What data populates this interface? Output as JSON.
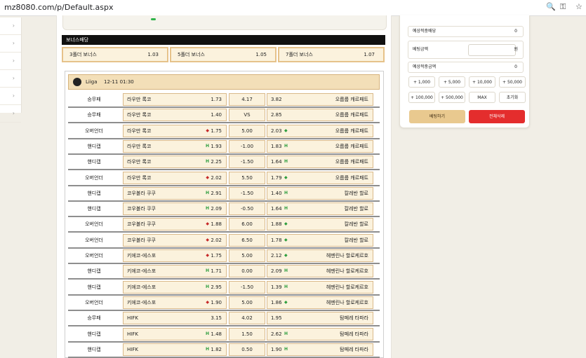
{
  "browser": {
    "url": "mz8080.com/p/Default.aspx",
    "zoom_icon": "magnifier-icon",
    "key_icon": "key-icon",
    "star_icon": "star-icon"
  },
  "sidebar": {
    "items": [
      "›",
      "›",
      "›",
      "›",
      "›",
      "›"
    ]
  },
  "bonus": {
    "header": "보너스배당",
    "items": [
      {
        "label": "3폴더 보너스",
        "value": "1.03"
      },
      {
        "label": "5폴더 보너스",
        "value": "1.05"
      },
      {
        "label": "7폴더 보너스",
        "value": "1.07"
      }
    ]
  },
  "league": {
    "name": "Liiga",
    "time": "12-11 01:30"
  },
  "rows": [
    {
      "type": "승무패",
      "home": "라우만 록코",
      "home_odd": "1.73",
      "mid": "4.17",
      "away_odd": "3.82",
      "away": "오룹룹 캐르패트",
      "hm": "",
      "am": ""
    },
    {
      "type": "승무패",
      "home": "라우만 록코",
      "home_odd": "1.40",
      "mid": "VS",
      "away_odd": "2.85",
      "away": "오룹룹 캐르패트",
      "hm": "",
      "am": ""
    },
    {
      "type": "오버언더",
      "home": "라우만 록코",
      "home_odd": "1.75",
      "mid": "5.00",
      "away_odd": "2.03",
      "away": "오룹룹 캐르패트",
      "hm": "◆",
      "am": "◆"
    },
    {
      "type": "핸디캡",
      "home": "라우만 록코",
      "home_odd": "1.93",
      "mid": "-1.00",
      "away_odd": "1.83",
      "away": "오룹룹 캐르패트",
      "hm": "H",
      "am": "H"
    },
    {
      "type": "핸디캡",
      "home": "라우만 록코",
      "home_odd": "2.25",
      "mid": "-1.50",
      "away_odd": "1.64",
      "away": "오룹룹 캐르패트",
      "hm": "H",
      "am": "H"
    },
    {
      "type": "오버언더",
      "home": "라우만 록코",
      "home_odd": "2.02",
      "mid": "5.50",
      "away_odd": "1.79",
      "away": "오룹룹 캐르패트",
      "hm": "◆",
      "am": "◆"
    },
    {
      "type": "핸디캡",
      "home": "코우볼라 쿠쿠",
      "home_odd": "2.91",
      "mid": "-1.50",
      "away_odd": "1.40",
      "away": "칼레반 할로",
      "hm": "H",
      "am": "H"
    },
    {
      "type": "핸디캡",
      "home": "코우볼라 쿠쿠",
      "home_odd": "2.09",
      "mid": "-0.50",
      "away_odd": "1.64",
      "away": "칼레반 할로",
      "hm": "H",
      "am": "H"
    },
    {
      "type": "오버언더",
      "home": "코우볼라 쿠쿠",
      "home_odd": "1.88",
      "mid": "6.00",
      "away_odd": "1.88",
      "away": "칼레반 할로",
      "hm": "◆",
      "am": "◆"
    },
    {
      "type": "오버언더",
      "home": "코우볼라 쿠쿠",
      "home_odd": "2.02",
      "mid": "6.50",
      "away_odd": "1.78",
      "away": "칼레반 할로",
      "hm": "◆",
      "am": "◆"
    },
    {
      "type": "오버언더",
      "home": "키에코-에스포",
      "home_odd": "1.75",
      "mid": "5.00",
      "away_odd": "2.12",
      "away": "헤멘린나 할로케르호",
      "hm": "◆",
      "am": "◆"
    },
    {
      "type": "핸디캡",
      "home": "키에코-에스포",
      "home_odd": "1.71",
      "mid": "0.00",
      "away_odd": "2.09",
      "away": "헤멘린나 할로케르호",
      "hm": "H",
      "am": "H"
    },
    {
      "type": "핸디캡",
      "home": "키에코-에스포",
      "home_odd": "2.95",
      "mid": "-1.50",
      "away_odd": "1.39",
      "away": "헤멘린나 할로케르호",
      "hm": "H",
      "am": "H"
    },
    {
      "type": "오버언더",
      "home": "키에코-에스포",
      "home_odd": "1.90",
      "mid": "5.00",
      "away_odd": "1.86",
      "away": "헤멘린나 할로케르호",
      "hm": "◆",
      "am": "◆"
    },
    {
      "type": "승무패",
      "home": "HIFK",
      "home_odd": "3.15",
      "mid": "4.02",
      "away_odd": "1.95",
      "away": "탐페레 타파라",
      "hm": "",
      "am": ""
    },
    {
      "type": "핸디캡",
      "home": "HIFK",
      "home_odd": "1.48",
      "mid": "1.50",
      "away_odd": "2.62",
      "away": "탐페레 타파라",
      "hm": "H",
      "am": "H"
    },
    {
      "type": "핸디캡",
      "home": "HIFK",
      "home_odd": "1.82",
      "mid": "0.50",
      "away_odd": "1.90",
      "away": "탐페레 타파라",
      "hm": "H",
      "am": "H"
    }
  ],
  "slip": {
    "expected_odds_label": "예상적중배당",
    "expected_odds_value": "0",
    "bet_amount_label": "베팅금액",
    "bet_amount_value": "",
    "bet_amount_unit": "원",
    "expected_win_label": "예상적중금액",
    "expected_win_value": "0",
    "chips": [
      "+ 1,000",
      "+ 5,000",
      "+ 10,000",
      "+ 50,000",
      "+ 100,000",
      "+ 500,000",
      "MAX",
      "초기화"
    ],
    "bet_button": "베팅하기",
    "delete_button": "전체삭제"
  },
  "colors": {
    "accent_gold": "#e9c98f",
    "danger_red": "#e42d2d",
    "cell_bg": "#fbf2dd"
  }
}
